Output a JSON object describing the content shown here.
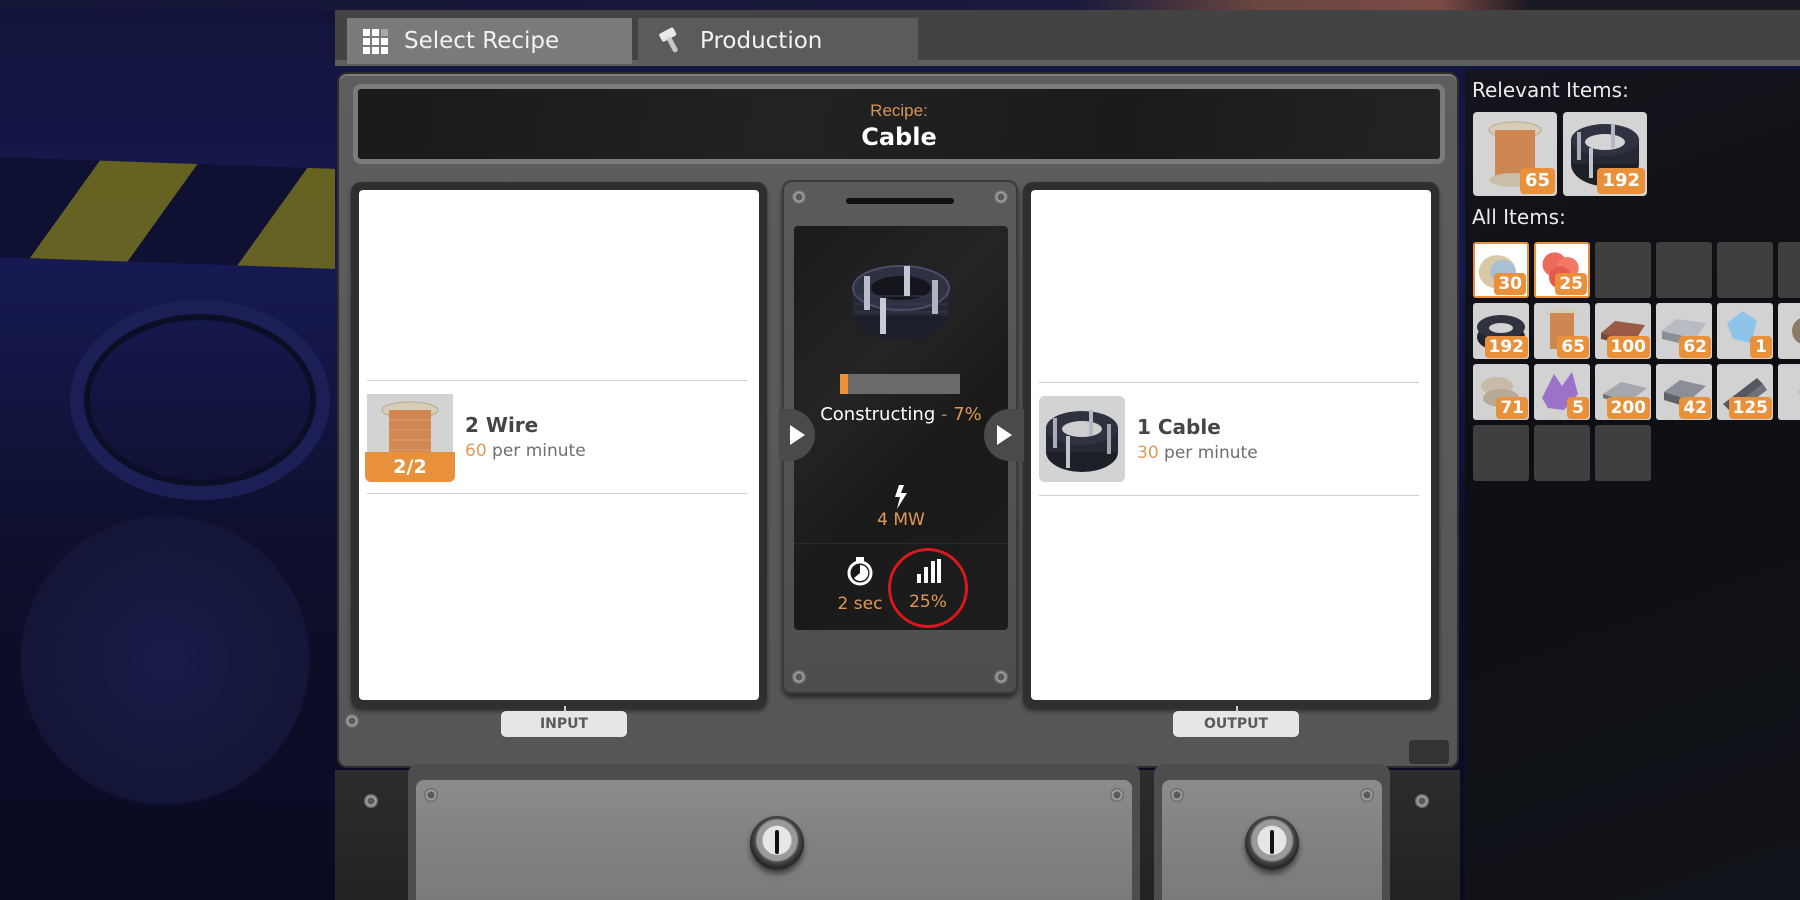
{
  "tabs": [
    {
      "label": "Select Recipe",
      "icon": "grid-icon",
      "active": true
    },
    {
      "label": "Production",
      "icon": "hammer-icon",
      "active": false
    }
  ],
  "recipe": {
    "label": "Recipe:",
    "name": "Cable"
  },
  "input": {
    "tag": "INPUT",
    "items": [
      {
        "name": "2 Wire",
        "rate": "60",
        "rate_unit": "per minute",
        "slot_count": "2/2",
        "icon": "wire-spool-icon"
      }
    ]
  },
  "output": {
    "tag": "OUTPUT",
    "items": [
      {
        "name": "1 Cable",
        "rate": "30",
        "rate_unit": "per minute",
        "icon": "cable-coil-icon"
      }
    ]
  },
  "process": {
    "product_icon": "cable-coil-icon",
    "status": "Constructing",
    "separator": "-",
    "progress_label": "7%",
    "progress": 0.07,
    "power": "4 MW",
    "cycle_time": "2 sec",
    "efficiency": "25%"
  },
  "inventory": {
    "relevant_title": "Relevant Items:",
    "all_title": "All Items:",
    "relevant": [
      {
        "icon": "wire-spool-icon",
        "count": "65"
      },
      {
        "icon": "cable-coil-icon",
        "count": "192"
      }
    ],
    "all": [
      {
        "icon": "limestone-shell-icon",
        "count": "30",
        "state": "fresh"
      },
      {
        "icon": "red-coral-icon",
        "count": "25",
        "state": "fresh"
      },
      {
        "icon": "",
        "count": "",
        "state": "empty"
      },
      {
        "icon": "",
        "count": "",
        "state": "empty"
      },
      {
        "icon": "",
        "count": "",
        "state": "empty"
      },
      {
        "icon": "",
        "count": "",
        "state": "empty"
      },
      {
        "icon": "cable-coil-icon",
        "count": "192",
        "state": "full"
      },
      {
        "icon": "wire-spool-icon",
        "count": "65",
        "state": "full"
      },
      {
        "icon": "copper-ingot-icon",
        "count": "100",
        "state": "full"
      },
      {
        "icon": "iron-ingot-icon",
        "count": "62",
        "state": "full"
      },
      {
        "icon": "blue-crystal-icon",
        "count": "1",
        "state": "full"
      },
      {
        "icon": "ore-chunk-icon",
        "count": "",
        "state": "full"
      },
      {
        "icon": "stone-icon",
        "count": "71",
        "state": "full"
      },
      {
        "icon": "purple-crystal-icon",
        "count": "5",
        "state": "full"
      },
      {
        "icon": "iron-plate-icon",
        "count": "200",
        "state": "full"
      },
      {
        "icon": "steel-plate-icon",
        "count": "42",
        "state": "full"
      },
      {
        "icon": "iron-rod-icon",
        "count": "125",
        "state": "full"
      },
      {
        "icon": "metal-sheet-icon",
        "count": "",
        "state": "full"
      },
      {
        "icon": "",
        "count": "",
        "state": "empty"
      },
      {
        "icon": "",
        "count": "",
        "state": "empty"
      },
      {
        "icon": "",
        "count": "",
        "state": "empty"
      }
    ]
  },
  "colors": {
    "accent": "#e8913a",
    "highlight_ring": "#d9181e",
    "tab_active": "#7a7a7a",
    "tab_inactive": "#5b5b5b"
  }
}
